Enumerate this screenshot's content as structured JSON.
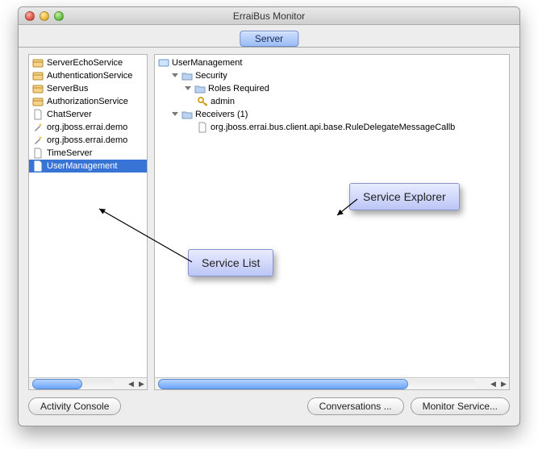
{
  "window": {
    "title": "ErraiBus Monitor"
  },
  "tabs": {
    "server": "Server"
  },
  "services": [
    {
      "label": "ServerEchoService",
      "icon": "package"
    },
    {
      "label": "AuthenticationService",
      "icon": "package"
    },
    {
      "label": "ServerBus",
      "icon": "package"
    },
    {
      "label": "AuthorizationService",
      "icon": "package"
    },
    {
      "label": "ChatServer",
      "icon": "file"
    },
    {
      "label": "org.jboss.errai.demo",
      "icon": "wand"
    },
    {
      "label": "org.jboss.errai.demo",
      "icon": "wand"
    },
    {
      "label": "TimeServer",
      "icon": "file"
    },
    {
      "label": "UserManagement",
      "icon": "file",
      "selected": true
    }
  ],
  "tree": {
    "root": "UserManagement",
    "security": "Security",
    "roles_required": "Roles Required",
    "admin": "admin",
    "receivers": "Receivers (1)",
    "receiver0": "org.jboss.errai.bus.client.api.base.RuleDelegateMessageCallb"
  },
  "buttons": {
    "activity_console": "Activity Console",
    "conversations": "Conversations ...",
    "monitor_service": "Monitor Service..."
  },
  "annotations": {
    "service_explorer": "Service Explorer",
    "service_list": "Service List"
  }
}
